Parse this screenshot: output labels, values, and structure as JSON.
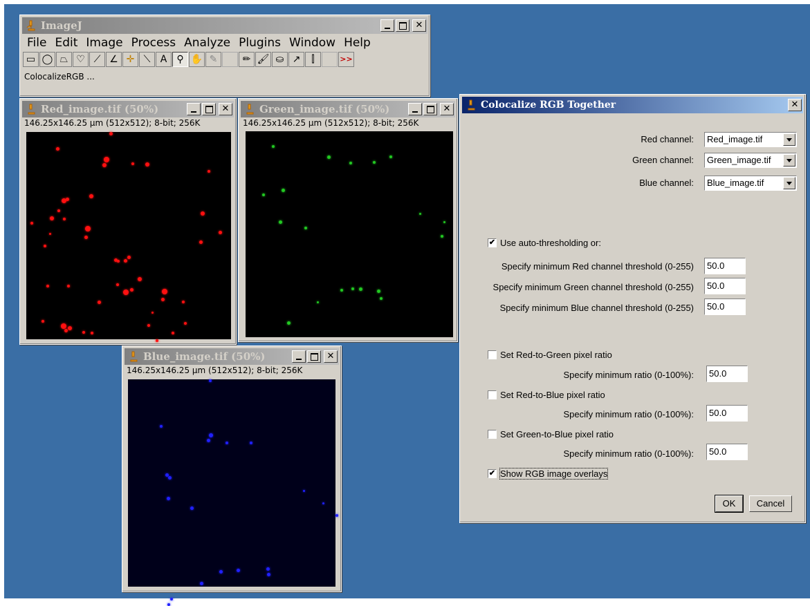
{
  "imagej": {
    "title": "ImageJ",
    "menu": [
      "File",
      "Edit",
      "Image",
      "Process",
      "Analyze",
      "Plugins",
      "Window",
      "Help"
    ],
    "tools": [
      "rectangle",
      "oval",
      "polygon",
      "freehand",
      "line",
      "angle",
      "point",
      "wand",
      "text",
      "magnifier",
      "hand",
      "color-picker",
      "blank",
      "pencil",
      "brush",
      "flood-fill",
      "arrow",
      "developer-menu",
      "blank2",
      "more"
    ],
    "status": "ColocalizeRGB ..."
  },
  "red_window": {
    "title": "Red_image.tif (50%)",
    "info": "146.25x146.25 µm (512x512); 8-bit; 256K",
    "color": "#ff1010"
  },
  "green_window": {
    "title": "Green_image.tif (50%)",
    "info": "146.25x146.25 µm (512x512); 8-bit; 256K",
    "color": "#22c822"
  },
  "blue_window": {
    "title": "Blue_image.tif (50%)",
    "info": "146.25x146.25 µm (512x512); 8-bit; 256K",
    "color": "#2020ff"
  },
  "dialog": {
    "title": "Colocalize RGB Together",
    "red_channel_label": "Red channel:",
    "red_channel_value": "Red_image.tif",
    "green_channel_label": "Green channel:",
    "green_channel_value": "Green_image.tif",
    "blue_channel_label": "Blue channel:",
    "blue_channel_value": "Blue_image.tif",
    "auto_threshold_label": "Use auto-thresholding or:",
    "auto_threshold_checked": true,
    "red_threshold_label": "Specify minimum Red channel threshold (0-255)",
    "red_threshold_value": "50.0",
    "green_threshold_label": "Specify minimum Green channel threshold (0-255)",
    "green_threshold_value": "50.0",
    "blue_threshold_label": "Specify minimum Blue channel threshold (0-255)",
    "blue_threshold_value": "50.0",
    "rg_ratio_label": "Set Red-to-Green pixel ratio",
    "rg_ratio_checked": false,
    "rb_ratio_label": "Set Red-to-Blue pixel ratio",
    "rb_ratio_checked": false,
    "gb_ratio_label": "Set Green-to-Blue pixel ratio",
    "gb_ratio_checked": false,
    "min_ratio_label": "Specify minimum ratio (0-100%):",
    "rg_min_ratio_value": "50.0",
    "rb_min_ratio_value": "50.0",
    "gb_min_ratio_value": "50.0",
    "overlay_label": "Show RGB image overlays",
    "overlay_checked": true,
    "ok_label": "OK",
    "cancel_label": "Cancel"
  },
  "colors": {
    "desktop": "#3a6ea5",
    "active_title": "#0a246a",
    "inactive_title": "#808080",
    "window_face": "#d4d0c8"
  }
}
